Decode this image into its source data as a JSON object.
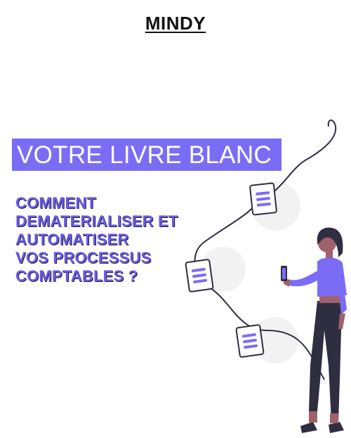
{
  "header": {
    "brand": "MINDY"
  },
  "banner": {
    "title": "VOTRE LIVRE BLANC"
  },
  "subtitle": {
    "lines": [
      "COMMENT",
      "DEMATERIALISER ET",
      "AUTOMATISER",
      "VOS PROCESSUS",
      "COMPTABLES ?"
    ]
  },
  "colors": {
    "accent": "#7b6cf6",
    "dark": "#2f2e41",
    "circle": "#f2f2f2",
    "skin": "#a0616a"
  }
}
